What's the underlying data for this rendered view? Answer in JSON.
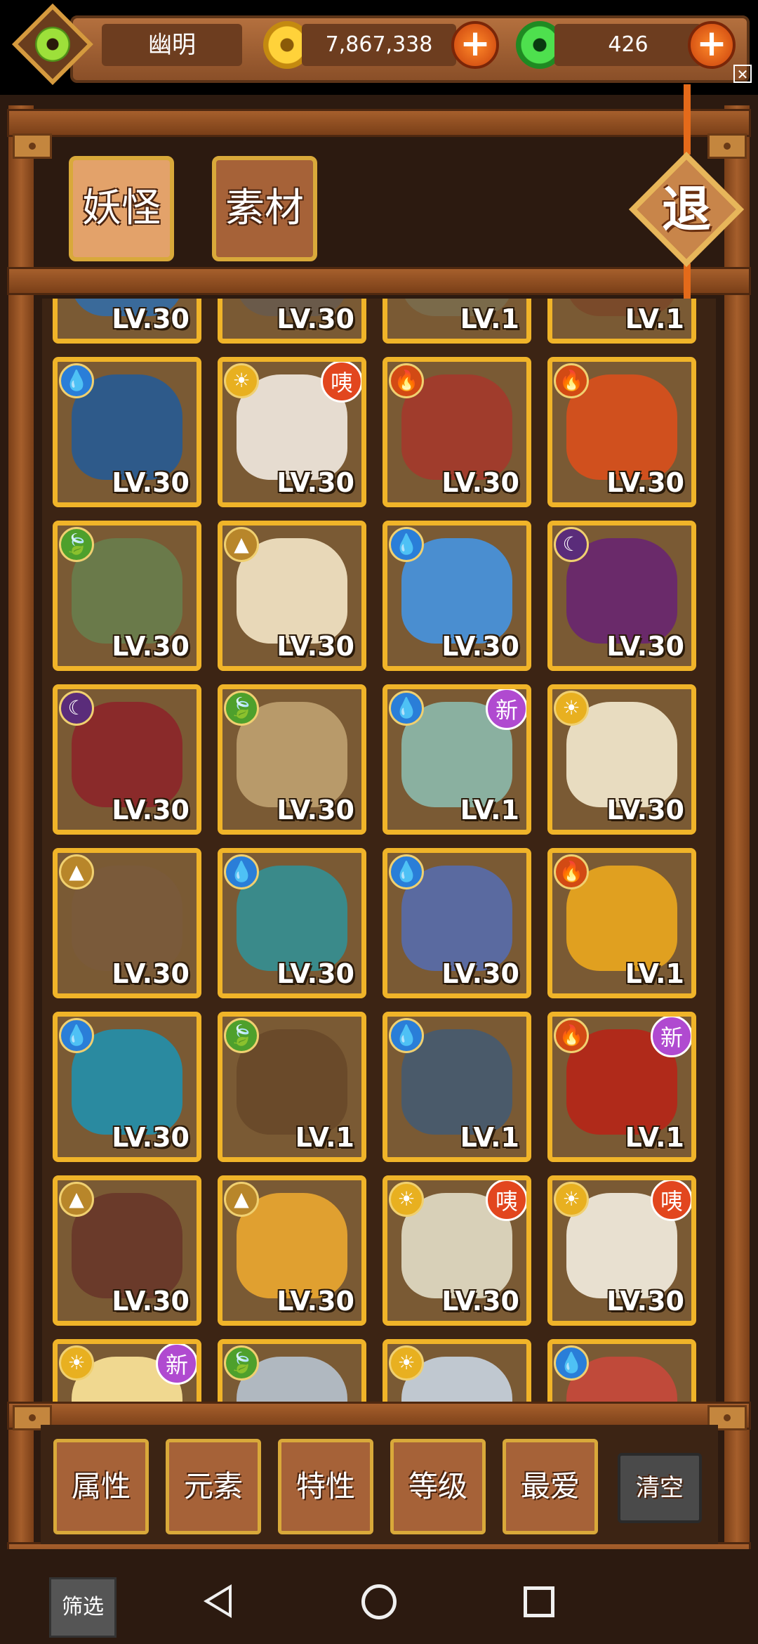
{
  "player": {
    "name": "幽明"
  },
  "currency": {
    "gold": "7,867,338",
    "jade": "426"
  },
  "tabs": [
    {
      "label": "妖怪",
      "active": true
    },
    {
      "label": "素材",
      "active": false
    }
  ],
  "exit_label": "退",
  "cards": [
    {
      "element": "water",
      "level": "LV.30",
      "badge": "",
      "art": "#3a6a9a"
    },
    {
      "element": "light",
      "level": "LV.30",
      "badge": "",
      "art": "#6a5a4a"
    },
    {
      "element": "light",
      "level": "LV.1",
      "badge": "",
      "art": "#7a6a4a"
    },
    {
      "element": "fire",
      "level": "LV.1",
      "badge": "",
      "art": "#7a4a2a"
    },
    {
      "element": "water",
      "level": "LV.30",
      "badge": "",
      "art": "#2e5a8a"
    },
    {
      "element": "light",
      "level": "LV.30",
      "badge": "咦",
      "art": "#e6dcd0"
    },
    {
      "element": "fire",
      "level": "LV.30",
      "badge": "",
      "art": "#a03c2c"
    },
    {
      "element": "fire",
      "level": "LV.30",
      "badge": "",
      "art": "#d0501e"
    },
    {
      "element": "wood",
      "level": "LV.30",
      "badge": "",
      "art": "#6a7a4a"
    },
    {
      "element": "earth",
      "level": "LV.30",
      "badge": "",
      "art": "#e8d8b8"
    },
    {
      "element": "water",
      "level": "LV.30",
      "badge": "",
      "art": "#4a8ed0"
    },
    {
      "element": "dark",
      "level": "LV.30",
      "badge": "",
      "art": "#6a2a6a"
    },
    {
      "element": "dark",
      "level": "LV.30",
      "badge": "",
      "art": "#8a2a2a"
    },
    {
      "element": "wood",
      "level": "LV.30",
      "badge": "",
      "art": "#b89a6a"
    },
    {
      "element": "water",
      "level": "LV.1",
      "badge": "新",
      "art": "#8ab0a0"
    },
    {
      "element": "light",
      "level": "LV.30",
      "badge": "",
      "art": "#e8dcc0"
    },
    {
      "element": "earth",
      "level": "LV.30",
      "badge": "",
      "art": "#7a5a3a"
    },
    {
      "element": "water",
      "level": "LV.30",
      "badge": "",
      "art": "#3a8a8a"
    },
    {
      "element": "water",
      "level": "LV.30",
      "badge": "",
      "art": "#5a6aa0"
    },
    {
      "element": "fire",
      "level": "LV.1",
      "badge": "",
      "art": "#e0a020"
    },
    {
      "element": "water",
      "level": "LV.30",
      "badge": "",
      "art": "#2a8aa0"
    },
    {
      "element": "wood",
      "level": "LV.1",
      "badge": "",
      "art": "#6a4a2a"
    },
    {
      "element": "water",
      "level": "LV.1",
      "badge": "",
      "art": "#4a5a6a"
    },
    {
      "element": "fire",
      "level": "LV.1",
      "badge": "新",
      "art": "#b02a1a"
    },
    {
      "element": "earth",
      "level": "LV.30",
      "badge": "",
      "art": "#6a3a2a"
    },
    {
      "element": "earth",
      "level": "LV.30",
      "badge": "",
      "art": "#e0a030"
    },
    {
      "element": "light",
      "level": "LV.30",
      "badge": "咦",
      "art": "#d8d0b8"
    },
    {
      "element": "light",
      "level": "LV.30",
      "badge": "咦",
      "art": "#e8e0d0"
    },
    {
      "element": "light",
      "level": "",
      "badge": "新",
      "art": "#f0d890"
    },
    {
      "element": "wood",
      "level": "",
      "badge": "",
      "art": "#b0b8c0"
    },
    {
      "element": "light",
      "level": "",
      "badge": "",
      "art": "#c0c8d0"
    },
    {
      "element": "water",
      "level": "",
      "badge": "",
      "art": "#c04a3a"
    }
  ],
  "filters": [
    {
      "label": "属性"
    },
    {
      "label": "元素"
    },
    {
      "label": "特性"
    },
    {
      "label": "等级"
    },
    {
      "label": "最爱"
    }
  ],
  "clear_label": "清空",
  "sift_label": "筛选",
  "element_glyphs": {
    "water": "💧",
    "fire": "🔥",
    "wood": "🍃",
    "earth": "▲",
    "light": "☀",
    "dark": "☾"
  }
}
